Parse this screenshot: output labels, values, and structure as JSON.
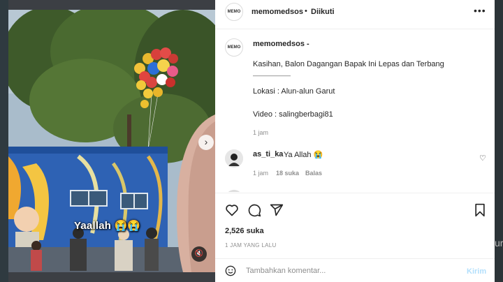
{
  "header": {
    "username": "memomedsos",
    "separator": "•",
    "follow_label": "Diikuti",
    "more_label": "•••",
    "avatar_text": "MEMO"
  },
  "video": {
    "caption": "Yaallah 😭😭",
    "next_label": "›",
    "mute_label": "🔇"
  },
  "post": {
    "username": "memomedsos -",
    "lines": [
      "Kasihan, Balon Dagangan Bapak Ini Lepas dan Terbang",
      "――――――",
      "Lokasi : Alun-alun Garut",
      "Video : salingberbagi81"
    ],
    "time": "1 jam"
  },
  "comments": [
    {
      "username": "as_ti_ka",
      "text": "Ya Allah 😭",
      "time": "1 jam",
      "likes": "18 suka",
      "reply_label": "Balas"
    }
  ],
  "actions": {
    "likes": "2,526 suka",
    "date": "1 JAM YANG LALU"
  },
  "comment_bar": {
    "placeholder": "Tambahkan komentar...",
    "post_label": "Kirim"
  },
  "backdrop": {
    "edge_text": "ur"
  },
  "colors": {
    "accent": "#0095f6",
    "post_disabled": "#b2dffc",
    "muted": "#8e8e8e"
  }
}
